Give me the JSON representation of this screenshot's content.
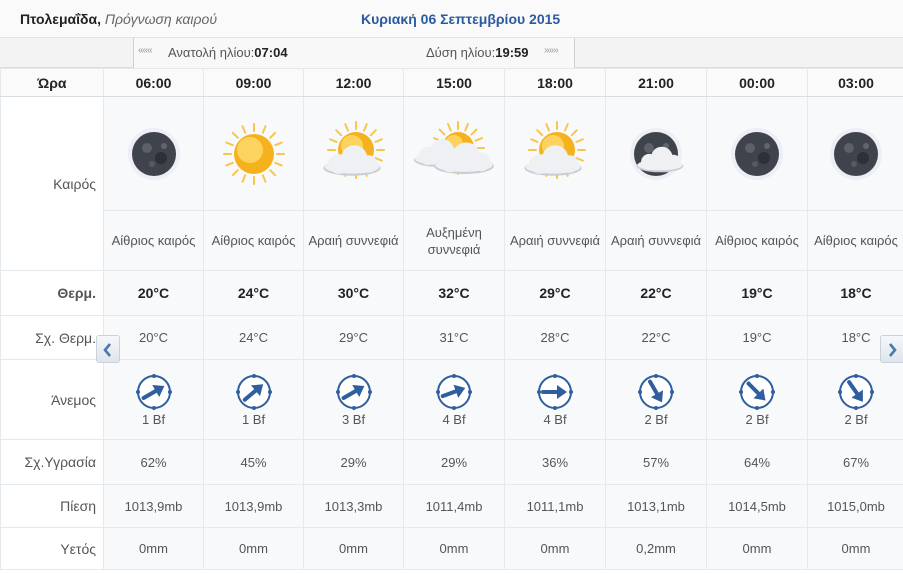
{
  "header": {
    "city": "Πτολεμαΐδα,",
    "subtitle": "Πρόγνωση καιρού",
    "date": "Κυριακή 06 Σεπτεμβρίου 2015"
  },
  "sunbar": {
    "prev_nav": "«««",
    "next_nav": "»»»",
    "sunrise_label": "Ανατολή ηλίου:",
    "sunrise_time": "07:04",
    "sunset_label": "Δύση ηλίου:",
    "sunset_time": "19:59"
  },
  "labels": {
    "hour": "Ώρα",
    "weather": "Καιρός",
    "temp": "Θερμ.",
    "feels": "Σχ. Θερμ.",
    "wind": "Άνεμος",
    "humidity": "Σχ.Υγρασία",
    "pressure": "Πίεση",
    "rain": "Υετός"
  },
  "columns": [
    {
      "time": "06:00",
      "icon": "moon-clear-icon",
      "desc": "Αίθριος καιρός",
      "temp": "20°C",
      "feels": "20°C",
      "wind_dir_deg": 60,
      "wind": "1 Bf",
      "humidity": "62%",
      "pressure": "1013,9mb",
      "rain": "0mm"
    },
    {
      "time": "09:00",
      "icon": "sun-clear-icon",
      "desc": "Αίθριος καιρός",
      "temp": "24°C",
      "feels": "24°C",
      "wind_dir_deg": 50,
      "wind": "1 Bf",
      "humidity": "45%",
      "pressure": "1013,9mb",
      "rain": "0mm"
    },
    {
      "time": "12:00",
      "icon": "sun-cloud-icon",
      "desc": "Αραιή συννεφιά",
      "temp": "30°C",
      "feels": "29°C",
      "wind_dir_deg": 60,
      "wind": "3 Bf",
      "humidity": "29%",
      "pressure": "1013,3mb",
      "rain": "0mm"
    },
    {
      "time": "15:00",
      "icon": "sun-clouds-icon",
      "desc": "Αυξημένη συννεφιά",
      "temp": "32°C",
      "feels": "31°C",
      "wind_dir_deg": 70,
      "wind": "4 Bf",
      "humidity": "29%",
      "pressure": "1011,4mb",
      "rain": "0mm"
    },
    {
      "time": "18:00",
      "icon": "sun-cloud-icon",
      "desc": "Αραιή συννεφιά",
      "temp": "29°C",
      "feels": "28°C",
      "wind_dir_deg": 90,
      "wind": "4 Bf",
      "humidity": "36%",
      "pressure": "1011,1mb",
      "rain": "0mm"
    },
    {
      "time": "21:00",
      "icon": "moon-cloud-icon",
      "desc": "Αραιή συννεφιά",
      "temp": "22°C",
      "feels": "22°C",
      "wind_dir_deg": 150,
      "wind": "2 Bf",
      "humidity": "57%",
      "pressure": "1013,1mb",
      "rain": "0,2mm"
    },
    {
      "time": "00:00",
      "icon": "moon-clear-icon",
      "desc": "Αίθριος καιρός",
      "temp": "19°C",
      "feels": "19°C",
      "wind_dir_deg": 135,
      "wind": "2 Bf",
      "humidity": "64%",
      "pressure": "1014,5mb",
      "rain": "0mm"
    },
    {
      "time": "03:00",
      "icon": "moon-clear-icon",
      "desc": "Αίθριος καιρός",
      "temp": "18°C",
      "feels": "18°C",
      "wind_dir_deg": 145,
      "wind": "2 Bf",
      "humidity": "67%",
      "pressure": "1015,0mb",
      "rain": "0mm"
    }
  ],
  "colors": {
    "accent": "#2c5aa0",
    "wind_arrow": "#2f5f9e",
    "sun": "#f6b21e",
    "moon": "#3a3d44"
  }
}
